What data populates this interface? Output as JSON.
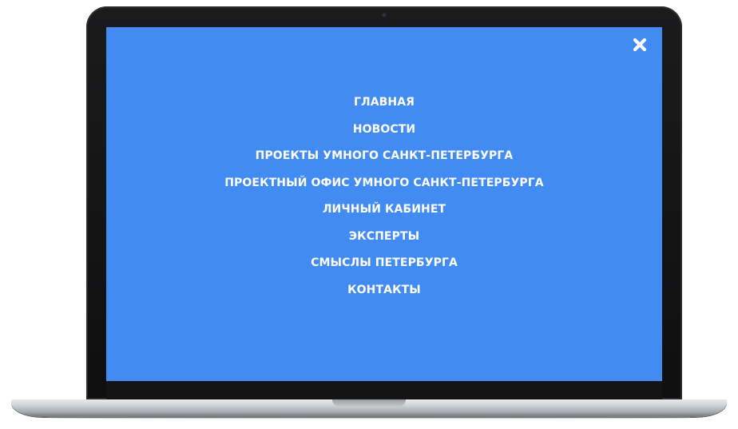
{
  "screen": {
    "background_color": "#428bf2",
    "text_color": "#ffffff"
  },
  "close_button": {
    "icon": "close-icon"
  },
  "nav": {
    "items": [
      {
        "label": "ГЛАВНАЯ"
      },
      {
        "label": "НОВОСТИ"
      },
      {
        "label": "ПРОЕКТЫ УМНОГО САНКТ-ПЕТЕРБУРГА"
      },
      {
        "label": "ПРОЕКТНЫЙ ОФИС УМНОГО САНКТ-ПЕТЕРБУРГА"
      },
      {
        "label": "ЛИЧНЫЙ КАБИНЕТ"
      },
      {
        "label": "ЭКСПЕРТЫ"
      },
      {
        "label": "СМЫСЛЫ ПЕТЕРБУРГА"
      },
      {
        "label": "КОНТАКТЫ"
      }
    ]
  }
}
